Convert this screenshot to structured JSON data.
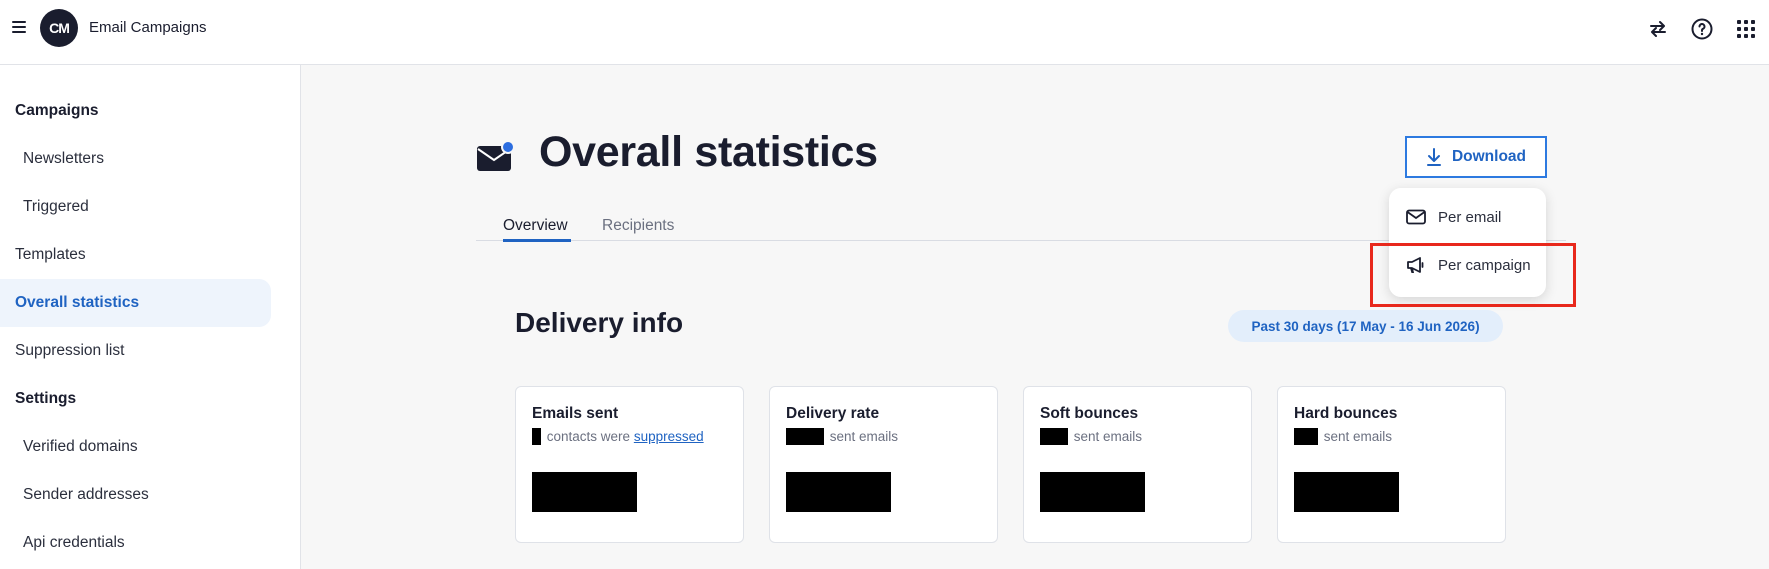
{
  "app": {
    "title": "Email Campaigns",
    "logo_text": "CM"
  },
  "topbar_icons": [
    "swap-icon",
    "help-icon",
    "apps-grid-icon"
  ],
  "sidebar": {
    "items": [
      {
        "label": "Campaigns",
        "type": "section"
      },
      {
        "label": "Newsletters",
        "type": "sub"
      },
      {
        "label": "Triggered",
        "type": "sub"
      },
      {
        "label": "Templates",
        "type": "item"
      },
      {
        "label": "Overall statistics",
        "type": "item",
        "active": true
      },
      {
        "label": "Suppression list",
        "type": "item"
      },
      {
        "label": "Settings",
        "type": "section"
      },
      {
        "label": "Verified domains",
        "type": "sub"
      },
      {
        "label": "Sender addresses",
        "type": "sub"
      },
      {
        "label": "Api credentials",
        "type": "sub"
      }
    ]
  },
  "page": {
    "title": "Overall statistics"
  },
  "tabs": [
    {
      "label": "Overview",
      "active": true
    },
    {
      "label": "Recipients",
      "active": false
    }
  ],
  "download": {
    "label": "Download",
    "menu": [
      {
        "label": "Per email",
        "icon": "envelope-icon"
      },
      {
        "label": "Per campaign",
        "icon": "megaphone-icon",
        "highlighted": true
      }
    ]
  },
  "delivery": {
    "title": "Delivery info",
    "date_range": "Past 30 days (17 May - 16 Jun 2026)",
    "cards": [
      {
        "title": "Emails sent",
        "sub_text": "contacts were",
        "sub_link": "suppressed"
      },
      {
        "title": "Delivery rate",
        "sub_text": "sent emails"
      },
      {
        "title": "Soft bounces",
        "sub_text": "sent emails"
      },
      {
        "title": "Hard bounces",
        "sub_text": "sent emails"
      }
    ]
  },
  "colors": {
    "accent": "#1f63c2",
    "highlight": "#e8281c",
    "logo_bg": "#1a1d2e"
  }
}
